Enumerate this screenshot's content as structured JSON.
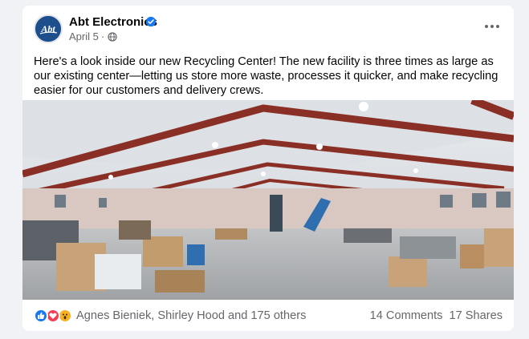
{
  "post": {
    "page_name": "Abt Electronics",
    "logo_text": "Abt",
    "date": "April 5",
    "separator": "·",
    "text": "Here's a look inside our new Recycling Center!  The new facility is three times as large as our existing center—letting us store more waste, processes it quicker, and make recycling easier for our customers and delivery crews."
  },
  "icons": {
    "avatar": "abt-logo",
    "verified": "verified-badge-icon",
    "audience": "globe-icon",
    "more": "more-options-icon",
    "reactions": [
      "like-icon",
      "love-icon",
      "wow-icon"
    ]
  },
  "engagement": {
    "reaction_names": "Agnes Bieniek, Shirley Hood and 175 others",
    "comments": "14 Comments",
    "shares": "17 Shares"
  },
  "colors": {
    "brand": "#1c4f8c",
    "like": "#1877f2",
    "love": "#f33e58",
    "wow": "#f7b125",
    "secondary_text": "#65676b"
  }
}
